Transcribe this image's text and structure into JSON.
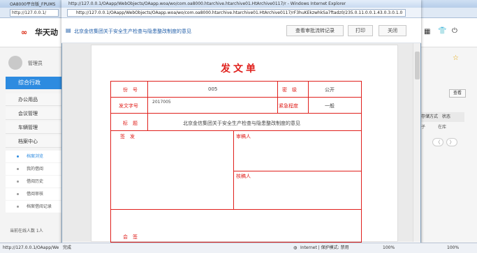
{
  "background_window": {
    "title": "OA8000平台版_FPUMS",
    "address": "http://127.0.0.1/",
    "logo_text": "华天动",
    "user_name": "管理员",
    "nav": {
      "admin": "综合行政",
      "items": [
        "办公用品",
        "会议管理",
        "车辆管理",
        "档案中心"
      ],
      "sub_items": [
        "档案浏览",
        "我的借阅",
        "借阅历史",
        "借阅审核",
        "档案借阅记录"
      ]
    },
    "online": "当前在线人数 1人",
    "query_button": "查看",
    "column_headers": "存储方式　状态",
    "column_cell": "子　　　在库",
    "status_url": "http://127.0.0.1/OAapp/We",
    "zoom": "100%"
  },
  "popup": {
    "title": "http://127.0.0.1/OAapp/WebObjects/OAapp.woa/wo/com.oa8000.htarchive.htarchive01.HtArchive0117/r - Windows Internet Explorer",
    "address": "http://127.0.0.1/OAapp/WebObjects/OAapp.woa/wo/com.oa8000.htarchive.htarchive01.HtArchive0117/rF3huKEkzwhkSa7ftadz0/235.0.11.0.0.1.43.0.3.0.1.0",
    "doc_title": "北京金信集团关于安全生产检查与隐患整改制度的意见",
    "buttons": {
      "history": "查看审批流转记录",
      "print": "打印",
      "close": "关闭"
    },
    "form": {
      "heading": "发文单",
      "number_label": "份　号",
      "number_value": "005",
      "secret_label": "密　级",
      "secret_value": "公开",
      "doc_no_label": "发文字号",
      "doc_no_value": "2017005",
      "urgency_label": "紧急程度",
      "urgency_value": "一般",
      "title_label": "标　题",
      "title_value": "北京金信集团关于安全生产检查与隐患整改制度的意见",
      "sign_label": "签　发",
      "review_label": "审稿人",
      "approve_label": "核稿人",
      "countersign_label": "会　签"
    },
    "status_text": "完成",
    "zone": "Internet | 保护模式: 禁用",
    "zoom": "100%"
  },
  "colors": {
    "accent": "#2d8be0",
    "form_red": "#e0201c",
    "link_blue": "#1f5da8"
  }
}
